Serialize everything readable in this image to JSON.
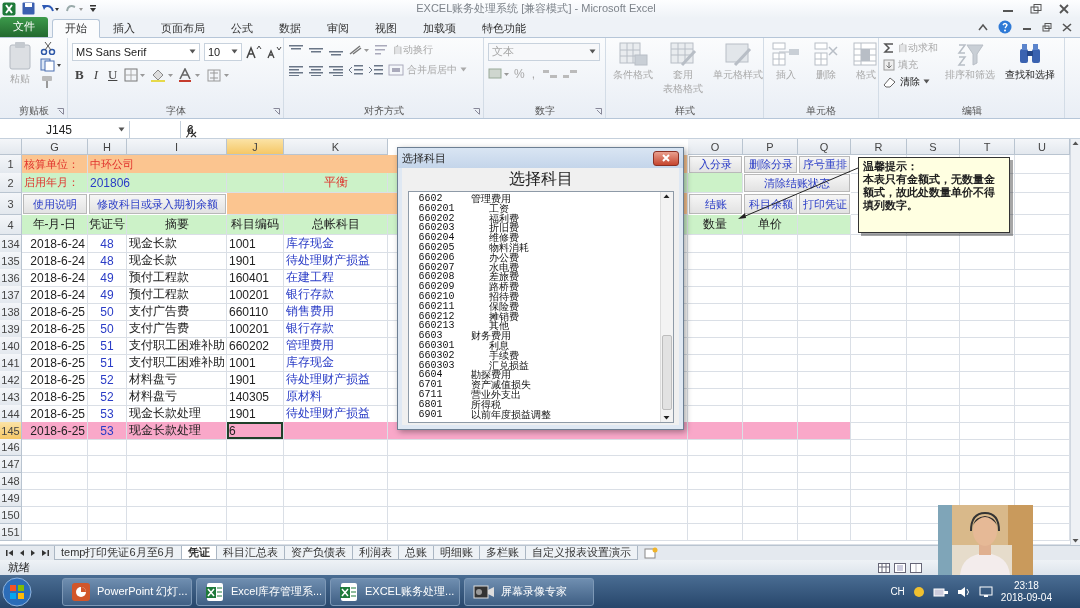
{
  "window": {
    "title": "EXCEL账务处理系统 [兼容模式] - Microsoft Excel"
  },
  "ribbon_tabs": [
    {
      "label": "文件",
      "kind": "file",
      "selected": false
    },
    {
      "label": "开始",
      "kind": "tab",
      "selected": true
    },
    {
      "label": "插入",
      "kind": "tab",
      "selected": false
    },
    {
      "label": "页面布局",
      "kind": "tab",
      "selected": false
    },
    {
      "label": "公式",
      "kind": "tab",
      "selected": false
    },
    {
      "label": "数据",
      "kind": "tab",
      "selected": false
    },
    {
      "label": "审阅",
      "kind": "tab",
      "selected": false
    },
    {
      "label": "视图",
      "kind": "tab",
      "selected": false
    },
    {
      "label": "加载项",
      "kind": "tab",
      "selected": false
    },
    {
      "label": "特色功能",
      "kind": "tab",
      "selected": false
    }
  ],
  "ribbon": {
    "clipboard": {
      "label": "剪贴板",
      "paste": {
        "label": "粘贴",
        "disabled": true
      }
    },
    "font": {
      "label": "字体",
      "font_name": "MS Sans Serif",
      "font_size": "10",
      "format_buttons": [
        "B",
        "I",
        "U"
      ]
    },
    "alignment": {
      "label": "对齐方式",
      "wrap_text": {
        "label": "自动换行",
        "disabled": true
      },
      "merge_center": {
        "label": "合并后居中",
        "disabled": true
      }
    },
    "number": {
      "label": "数字",
      "format": "文本",
      "percent": "%",
      "comma": ","
    },
    "styles": {
      "label": "样式",
      "commands": [
        {
          "label": "条件格式",
          "disabled": true
        },
        {
          "label": "套用",
          "label_2": "表格格式",
          "disabled": true
        },
        {
          "label": "单元格样式",
          "disabled": true
        }
      ]
    },
    "cells": {
      "label": "单元格",
      "commands": [
        {
          "label": "插入",
          "disabled": true
        },
        {
          "label": "删除",
          "disabled": true
        },
        {
          "label": "格式",
          "disabled": true
        }
      ]
    },
    "editing": {
      "label": "编辑",
      "autosum": {
        "label": "自动求和",
        "disabled": true
      },
      "fill": {
        "label": "填充",
        "disabled": true
      },
      "clear": {
        "label": "清除",
        "disabled": false
      },
      "sort_filter": {
        "label": "排序和筛选",
        "disabled": true
      },
      "find_select": {
        "label": "查找和选择",
        "disabled": false
      }
    }
  },
  "formula_bar": {
    "name_box": "J145",
    "value": "6"
  },
  "columns": [
    {
      "label": "G",
      "selected": false
    },
    {
      "label": "H",
      "selected": false
    },
    {
      "label": "I",
      "selected": false
    },
    {
      "label": "J",
      "selected": true
    },
    {
      "label": "K",
      "selected": false
    },
    {
      "label": "O",
      "selected": false
    },
    {
      "label": "P",
      "selected": false
    },
    {
      "label": "Q",
      "selected": false
    },
    {
      "label": "R",
      "selected": false
    },
    {
      "label": "S",
      "selected": false
    },
    {
      "label": "T",
      "selected": false
    },
    {
      "label": "U",
      "selected": false
    }
  ],
  "top_rows": [
    {
      "number": "1",
      "color": "#fbc590",
      "cells": [
        {
          "text": "核算单位：",
          "kind": "label"
        },
        {
          "text": "中环公司",
          "kind": "label"
        },
        {
          "text": "入分录",
          "kind": "button"
        },
        {
          "text": "删除分录",
          "kind": "button"
        },
        {
          "text": "序号重排",
          "kind": "button"
        }
      ]
    },
    {
      "number": "2",
      "color": "#ccf2c8",
      "cells": [
        {
          "text": "启用年月：",
          "kind": "label"
        },
        {
          "text": "201806",
          "kind": "value"
        },
        {
          "text": "平衡",
          "kind": "status"
        },
        {
          "text": "清除结账状态",
          "kind": "button"
        }
      ]
    },
    {
      "number": "3",
      "color": "#fbc590",
      "cells": [
        {
          "text": "使用说明",
          "kind": "button"
        },
        {
          "text": "修改科目或录入期初余额",
          "kind": "button"
        },
        {
          "text": "结账",
          "kind": "button"
        },
        {
          "text": "科目余额",
          "kind": "button"
        },
        {
          "text": "打印凭证",
          "kind": "button"
        }
      ]
    },
    {
      "number": "4",
      "color": "#ccf2c8",
      "cells": [
        {
          "text": "年-月-日",
          "kind": "header"
        },
        {
          "text": "凭证号",
          "kind": "header"
        },
        {
          "text": "摘要",
          "kind": "header"
        },
        {
          "text": "科目编码",
          "kind": "header"
        },
        {
          "text": "总帐科目",
          "kind": "header"
        },
        {
          "text": "数量",
          "kind": "header"
        },
        {
          "text": "单价",
          "kind": "header"
        }
      ]
    }
  ],
  "rows": [
    {
      "number": "134",
      "date": "2018-6-24",
      "voucher": "48",
      "summary": "现金长款",
      "code": "1001",
      "account": "库存现金",
      "selected": false
    },
    {
      "number": "135",
      "date": "2018-6-24",
      "voucher": "48",
      "summary": "现金长款",
      "code": "1901",
      "account": "待处理财产损益",
      "selected": false
    },
    {
      "number": "136",
      "date": "2018-6-24",
      "voucher": "49",
      "summary": "预付工程款",
      "code": "160401",
      "account": "在建工程",
      "selected": false
    },
    {
      "number": "137",
      "date": "2018-6-24",
      "voucher": "49",
      "summary": "预付工程款",
      "code": "100201",
      "account": "银行存款",
      "selected": false
    },
    {
      "number": "138",
      "date": "2018-6-25",
      "voucher": "50",
      "summary": "支付广告费",
      "code": "660110",
      "account": "销售费用",
      "selected": false
    },
    {
      "number": "139",
      "date": "2018-6-25",
      "voucher": "50",
      "summary": "支付广告费",
      "code": "100201",
      "account": "银行存款",
      "selected": false
    },
    {
      "number": "140",
      "date": "2018-6-25",
      "voucher": "51",
      "summary": "支付职工困难补助",
      "code": "660202",
      "account": "管理费用",
      "selected": false
    },
    {
      "number": "141",
      "date": "2018-6-25",
      "voucher": "51",
      "summary": "支付职工困难补助",
      "code": "1001",
      "account": "库存现金",
      "selected": false
    },
    {
      "number": "142",
      "date": "2018-6-25",
      "voucher": "52",
      "summary": "材料盘亏",
      "code": "1901",
      "account": "待处理财产损益",
      "selected": false
    },
    {
      "number": "143",
      "date": "2018-6-25",
      "voucher": "52",
      "summary": "材料盘亏",
      "code": "140305",
      "account": "原材料",
      "selected": false
    },
    {
      "number": "144",
      "date": "2018-6-25",
      "voucher": "53",
      "summary": "现金长款处理",
      "code": "1901",
      "account": "待处理财产损益",
      "selected": false
    },
    {
      "number": "145",
      "date": "2018-6-25",
      "voucher": "53",
      "summary": "现金长款处理",
      "code": "6",
      "selected": true
    }
  ],
  "empty_rows": [
    "146",
    "147",
    "148",
    "149",
    "150",
    "151"
  ],
  "comment": {
    "title": "温馨提示：",
    "text": "本表只有金额式，无数量金额式，故此处数量单价不得填列数字。"
  },
  "dialog": {
    "title": "选择科目",
    "heading": "选择科目",
    "accounts": [
      {
        "code": "6602",
        "name": "管理费用",
        "children": [
          {
            "code": "660201",
            "name": "工资"
          },
          {
            "code": "660202",
            "name": "福利费"
          },
          {
            "code": "660203",
            "name": "折旧费"
          },
          {
            "code": "660204",
            "name": "维修费"
          },
          {
            "code": "660205",
            "name": "物料消耗"
          },
          {
            "code": "660206",
            "name": "办公费"
          },
          {
            "code": "660207",
            "name": "水电费"
          },
          {
            "code": "660208",
            "name": "差旅费"
          },
          {
            "code": "660209",
            "name": "路桥费"
          },
          {
            "code": "660210",
            "name": "招待费"
          },
          {
            "code": "660211",
            "name": "保险费"
          },
          {
            "code": "660212",
            "name": "摊销费"
          },
          {
            "code": "660213",
            "name": "其他"
          }
        ]
      },
      {
        "code": "6603",
        "name": "财务费用",
        "children": [
          {
            "code": "660301",
            "name": "利息"
          },
          {
            "code": "660302",
            "name": "手续费"
          },
          {
            "code": "660303",
            "name": "汇兑损益"
          }
        ]
      },
      {
        "code": "6604",
        "name": "勘探费用"
      },
      {
        "code": "6701",
        "name": "资产减值损失"
      },
      {
        "code": "6711",
        "name": "营业外支出"
      },
      {
        "code": "6801",
        "name": "所得税"
      },
      {
        "code": "6901",
        "name": "以前年度损益调整"
      }
    ]
  },
  "sheet_tabs": [
    {
      "label": "temp打印凭证6月至6月",
      "selected": false
    },
    {
      "label": "凭证",
      "selected": true
    },
    {
      "label": "科目汇总表",
      "selected": false
    },
    {
      "label": "资产负债表",
      "selected": false
    },
    {
      "label": "利润表",
      "selected": false
    },
    {
      "label": "总账",
      "selected": false
    },
    {
      "label": "明细账",
      "selected": false
    },
    {
      "label": "多栏账",
      "selected": false
    },
    {
      "label": "自定义报表设置演示",
      "selected": false
    }
  ],
  "status_bar": {
    "text": "就绪"
  },
  "taskbar": {
    "items": [
      {
        "label": "PowerPoint 幻灯...",
        "kind": "powerpoint"
      },
      {
        "label": "Excel库存管理系...",
        "kind": "excel"
      },
      {
        "label": "EXCEL账务处理...",
        "kind": "excel"
      },
      {
        "label": "屏幕录像专家",
        "kind": "recorder"
      }
    ],
    "language": "CH",
    "time": "23:18",
    "date": "2018-09-04"
  }
}
